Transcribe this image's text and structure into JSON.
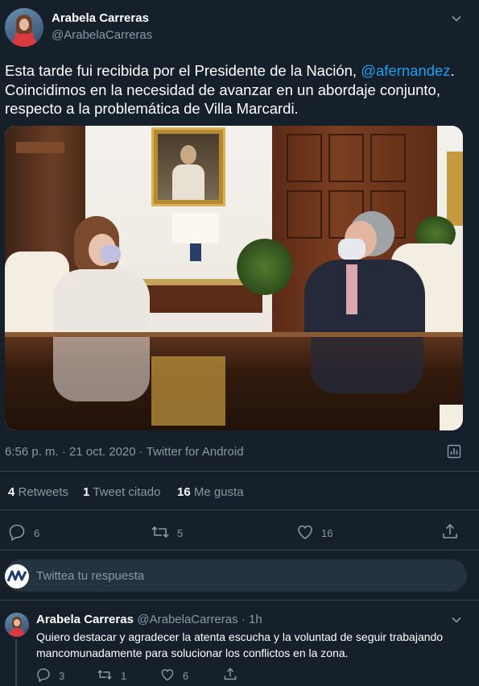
{
  "tweet": {
    "author_name": "Arabela Carreras",
    "author_handle": "@ArabelaCarreras",
    "text_before": "Esta tarde fui recibida por el Presidente de la Nación, ",
    "mention": "@afernandez",
    "text_after": ".\nCoincidimos en la necesidad de avanzar en un abordaje conjunto, respecto a la problemática de Villa Marcardi.",
    "timestamp": "6:56 p. m. · 21 oct. 2020 · Twitter for Android",
    "stats": {
      "retweets_count": "4",
      "retweets_label": "Retweets",
      "quotes_count": "1",
      "quotes_label": "Tweet citado",
      "likes_count": "16",
      "likes_label": "Me gusta"
    },
    "actions": {
      "reply_count": "6",
      "retweet_count": "5",
      "like_count": "16"
    }
  },
  "compose": {
    "placeholder": "Twittea tu respuesta"
  },
  "reply": {
    "author_name": "Arabela Carreras",
    "author_handle": "@ArabelaCarreras · 1h",
    "text": "Quiero destacar y agradecer la atenta escucha y la voluntad de seguir trabajando mancomunadamente para solucionar los conflictos en la zona.",
    "reply_count": "3",
    "retweet_count": "1",
    "like_count": "6"
  },
  "colors": {
    "background": "#15202b",
    "accent": "#1da1f2",
    "muted": "#8899a6",
    "divider": "#38444d"
  },
  "icons": [
    "chevron-down-icon",
    "analytics-icon",
    "reply-icon",
    "retweet-icon",
    "like-icon",
    "share-icon"
  ]
}
